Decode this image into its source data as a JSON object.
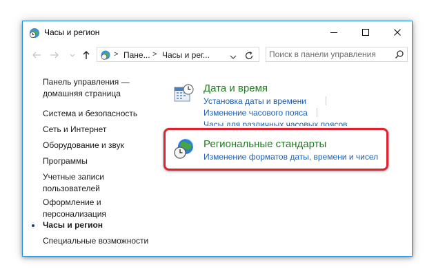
{
  "window": {
    "title": "Часы и регион",
    "icon": "clock-globe-icon"
  },
  "nav": {
    "back_icon": "back-arrow-icon",
    "forward_icon": "forward-arrow-icon",
    "up_icon": "up-arrow-icon"
  },
  "address": {
    "separator": ">",
    "crumbs": [
      "Пане...",
      "Часы и рег..."
    ]
  },
  "search": {
    "placeholder": "Поиск в панели управления"
  },
  "sidebar": {
    "items": [
      {
        "label": "Панель управления —\nдомашняя страница",
        "active": false
      },
      {
        "label": "Система и безопасность",
        "active": false
      },
      {
        "label": "Сеть и Интернет",
        "active": false
      },
      {
        "label": "Оборудование и звук",
        "active": false
      },
      {
        "label": "Программы",
        "active": false
      },
      {
        "label": "Учетные записи\nпользователей",
        "active": false
      },
      {
        "label": "Оформление и\nперсонализация",
        "active": false
      },
      {
        "label": "Часы и регион",
        "active": true
      },
      {
        "label": "Специальные возможности",
        "active": false
      }
    ]
  },
  "categories": [
    {
      "title": "Дата и время",
      "icon": "calendar-clock-icon",
      "links": [
        "Установка даты и времени",
        "Изменение часового пояса",
        "Часы для различных часовых поясов"
      ]
    },
    {
      "title": "Региональные стандарты",
      "icon": "globe-clock-icon",
      "links": [
        "Изменение форматов даты, времени и чисел"
      ]
    }
  ],
  "colors": {
    "category_title": "#1f7a1f",
    "link": "#1a5fb4",
    "highlight": "#e0202c",
    "window_border": "#1f8fe0"
  }
}
